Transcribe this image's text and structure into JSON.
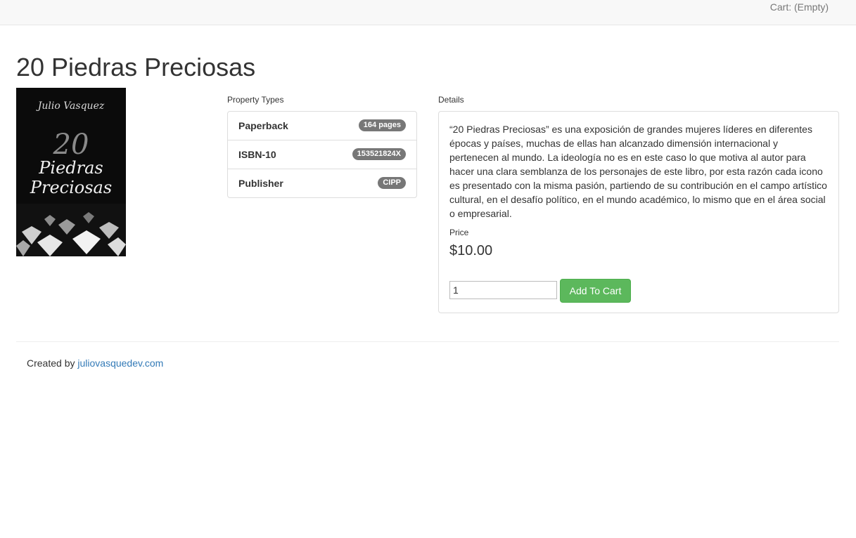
{
  "navbar": {
    "cart_label": "Cart: (Empty)"
  },
  "product": {
    "title": "20 Piedras Preciosas",
    "cover": {
      "author": "Julio Vasquez",
      "number": "20",
      "title_line1": "Piedras",
      "title_line2": "Preciosas"
    }
  },
  "properties": {
    "heading": "Property Types",
    "items": [
      {
        "label": "Paperback",
        "badge": "164 pages"
      },
      {
        "label": "ISBN-10",
        "badge": "153521824X"
      },
      {
        "label": "Publisher",
        "badge": "CIPP"
      }
    ]
  },
  "details": {
    "heading": "Details",
    "description": "“20 Piedras Preciosas” es una exposición de grandes mujeres líderes en diferentes épocas y países, muchas de ellas han alcanzado dimensión internacional y pertenecen al mundo. La ideología no es en este caso lo que motiva al autor para hacer una clara semblanza de los personajes de este libro, por esta razón cada icono es presentado con la misma pasión, partiendo de su contribución en el campo artístico cultural, en el desafío político, en el mundo académico, lo mismo que en el área social o empresarial.",
    "price_label": "Price",
    "price": "$10.00",
    "quantity": "1",
    "add_button": "Add To Cart"
  },
  "footer": {
    "prefix": "Created by",
    "link": "juliovasquedev.com"
  },
  "colors": {
    "accent_green": "#5cb85c",
    "link_blue": "#337ab7",
    "badge_gray": "#777777"
  }
}
